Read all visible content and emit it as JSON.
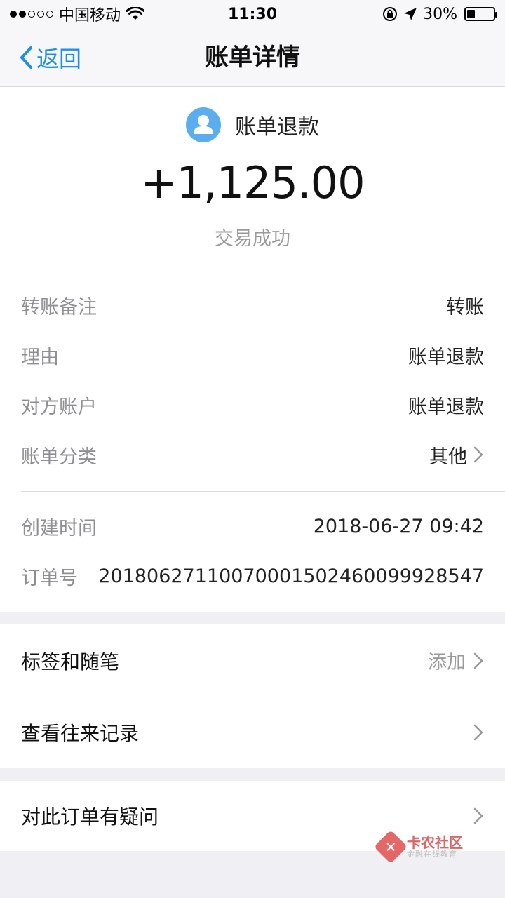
{
  "status_bar": {
    "carrier": "中国移动",
    "time": "11:30",
    "battery": "30%",
    "battery_level": 0.3,
    "signal_dots_filled": 2,
    "signal_dots_total": 5
  },
  "nav": {
    "back_label": "返回",
    "title": "账单详情"
  },
  "summary": {
    "payee": "账单退款",
    "amount": "+1,125.00",
    "status": "交易成功"
  },
  "details": [
    {
      "label": "转账备注",
      "value": "转账"
    },
    {
      "label": "理由",
      "value": "账单退款"
    },
    {
      "label": "对方账户",
      "value": "账单退款"
    },
    {
      "label": "账单分类",
      "value": "其他"
    }
  ],
  "meta": [
    {
      "label": "创建时间",
      "value": "2018-06-27 09:42"
    },
    {
      "label": "订单号",
      "value": "20180627110070001502460099928547"
    }
  ],
  "actions": {
    "tags_label": "标签和随笔",
    "tags_value": "添加",
    "history_label": "查看往来记录",
    "question_label": "对此订单有疑问"
  },
  "watermark": {
    "title": "卡农社区",
    "subtitle": "金融在线教育"
  },
  "colors": {
    "accent": "#1f8ee5",
    "avatar": "#5aaef0",
    "background": "#f0f0f4"
  },
  "icons": {
    "back": "chevron-left-icon",
    "avatar": "user-icon",
    "wifi": "wifi-icon",
    "lock": "rotation-lock-icon",
    "location": "location-arrow-icon",
    "battery": "battery-icon",
    "disclosure": "chevron-right-icon"
  }
}
